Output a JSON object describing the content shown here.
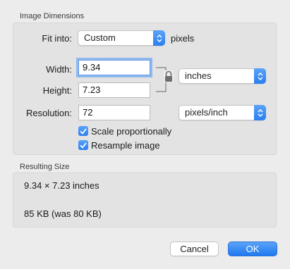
{
  "image_dimensions": {
    "title": "Image Dimensions",
    "fit_into": {
      "label": "Fit into:",
      "value": "Custom",
      "unit": "pixels"
    },
    "width": {
      "label": "Width:",
      "value": "9.34"
    },
    "height": {
      "label": "Height:",
      "value": "7.23"
    },
    "size_unit": "inches",
    "resolution": {
      "label": "Resolution:",
      "value": "72",
      "unit": "pixels/inch"
    },
    "scale_proportionally": {
      "label": "Scale proportionally",
      "checked": true
    },
    "resample_image": {
      "label": "Resample image",
      "checked": true
    }
  },
  "resulting_size": {
    "title": "Resulting Size",
    "dimensions": "9.34 × 7.23 inches",
    "file_size": "85 KB (was 80 KB)"
  },
  "buttons": {
    "cancel": "Cancel",
    "ok": "OK"
  },
  "colors": {
    "accent": "#2a7ef0",
    "focus_ring": "#5b9bf0",
    "background": "#ececec"
  }
}
